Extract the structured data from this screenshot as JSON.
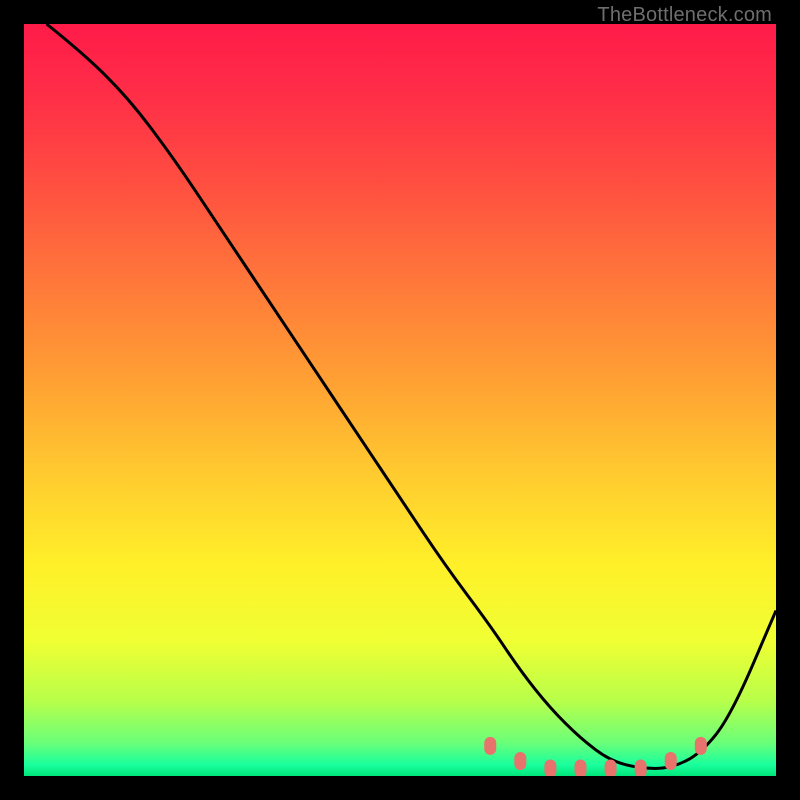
{
  "watermark": "TheBottleneck.com",
  "chart_data": {
    "type": "line",
    "title": "",
    "xlabel": "",
    "ylabel": "",
    "xlim": [
      0,
      100
    ],
    "ylim": [
      0,
      100
    ],
    "grid": false,
    "legend": false,
    "series": [
      {
        "name": "curve",
        "x": [
          3,
          8,
          14,
          20,
          26,
          32,
          38,
          44,
          50,
          56,
          62,
          66,
          70,
          74,
          78,
          82,
          86,
          90,
          94,
          100
        ],
        "y": [
          100,
          96,
          90,
          82,
          73,
          64,
          55,
          46,
          37,
          28,
          20,
          14,
          9,
          5,
          2,
          1,
          1,
          3,
          8,
          22
        ]
      },
      {
        "name": "markers",
        "x": [
          62,
          66,
          70,
          74,
          78,
          82,
          86,
          90
        ],
        "y": [
          4,
          2,
          1,
          1,
          1,
          1,
          2,
          4
        ]
      }
    ],
    "gradient_stops": [
      {
        "offset": 0.0,
        "color": "#ff1b49"
      },
      {
        "offset": 0.1,
        "color": "#ff2f47"
      },
      {
        "offset": 0.22,
        "color": "#ff5140"
      },
      {
        "offset": 0.35,
        "color": "#ff7a3a"
      },
      {
        "offset": 0.48,
        "color": "#ffa233"
      },
      {
        "offset": 0.6,
        "color": "#ffcb2f"
      },
      {
        "offset": 0.72,
        "color": "#fff029"
      },
      {
        "offset": 0.82,
        "color": "#f0ff33"
      },
      {
        "offset": 0.9,
        "color": "#b8ff4a"
      },
      {
        "offset": 0.955,
        "color": "#6cff78"
      },
      {
        "offset": 0.985,
        "color": "#1aff9d"
      },
      {
        "offset": 1.0,
        "color": "#00e57a"
      }
    ],
    "marker_color": "#e8726c",
    "curve_color": "#000000"
  }
}
